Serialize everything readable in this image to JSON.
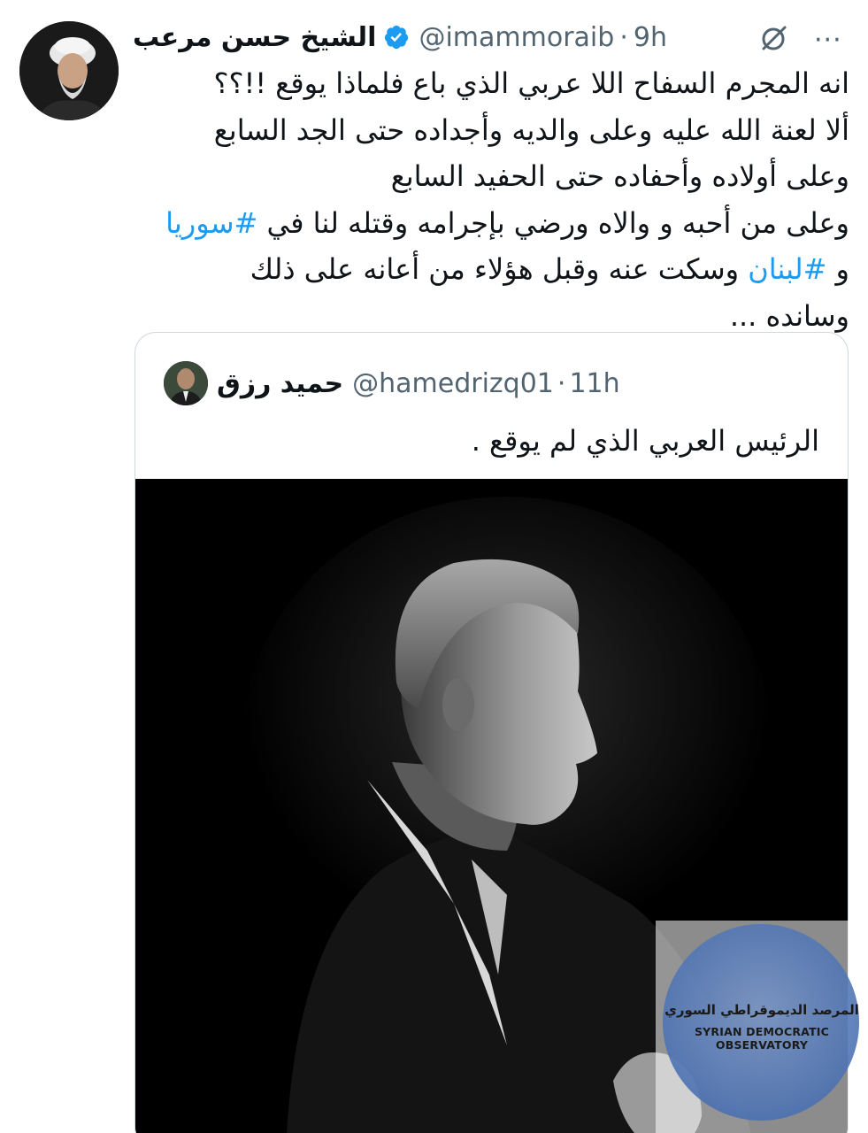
{
  "tweet": {
    "author_name": "الشيخ حسن مرعب",
    "handle": "@imammoraib",
    "separator": "·",
    "time": "9h",
    "more": "···",
    "lines": [
      {
        "text": "انه المجرم السفاح اللا عربي الذي باع فلماذا يوقع !!؟؟"
      },
      {
        "text": "ألا لعنة الله عليه وعلى والديه وأجداده حتى الجد السابع"
      },
      {
        "text": "وعلى أولاده وأحفاده حتى الحفيد السابع"
      },
      {
        "before": "وعلى من أحبه و والاه ورضي بإجرامه وقتله لنا في ",
        "hashtag": "#سوريا"
      },
      {
        "before": "و ",
        "hashtag": "#لبنان",
        "after": " وسكت عنه وقبل هؤلاء من أعانه على ذلك"
      },
      {
        "text": "وسانده ..."
      }
    ]
  },
  "quoted": {
    "author_name": "حميد رزق",
    "handle": "@hamedrizq01",
    "separator": "·",
    "time": "11h",
    "text": "الرئيس العربي الذي لم يوقع ."
  },
  "watermark": {
    "arabic": "المرصد الديموقراطي السوري",
    "english": "SYRIAN DEMOCRATIC OBSERVATORY"
  },
  "colors": {
    "text": "#0f1419",
    "secondary": "#536471",
    "link": "#1d9bf0",
    "verified": "#1d9bf0",
    "border": "#cfd9de"
  },
  "icons": {
    "verified": "verified-badge-icon",
    "grok": "grok-icon",
    "more": "more-icon"
  }
}
